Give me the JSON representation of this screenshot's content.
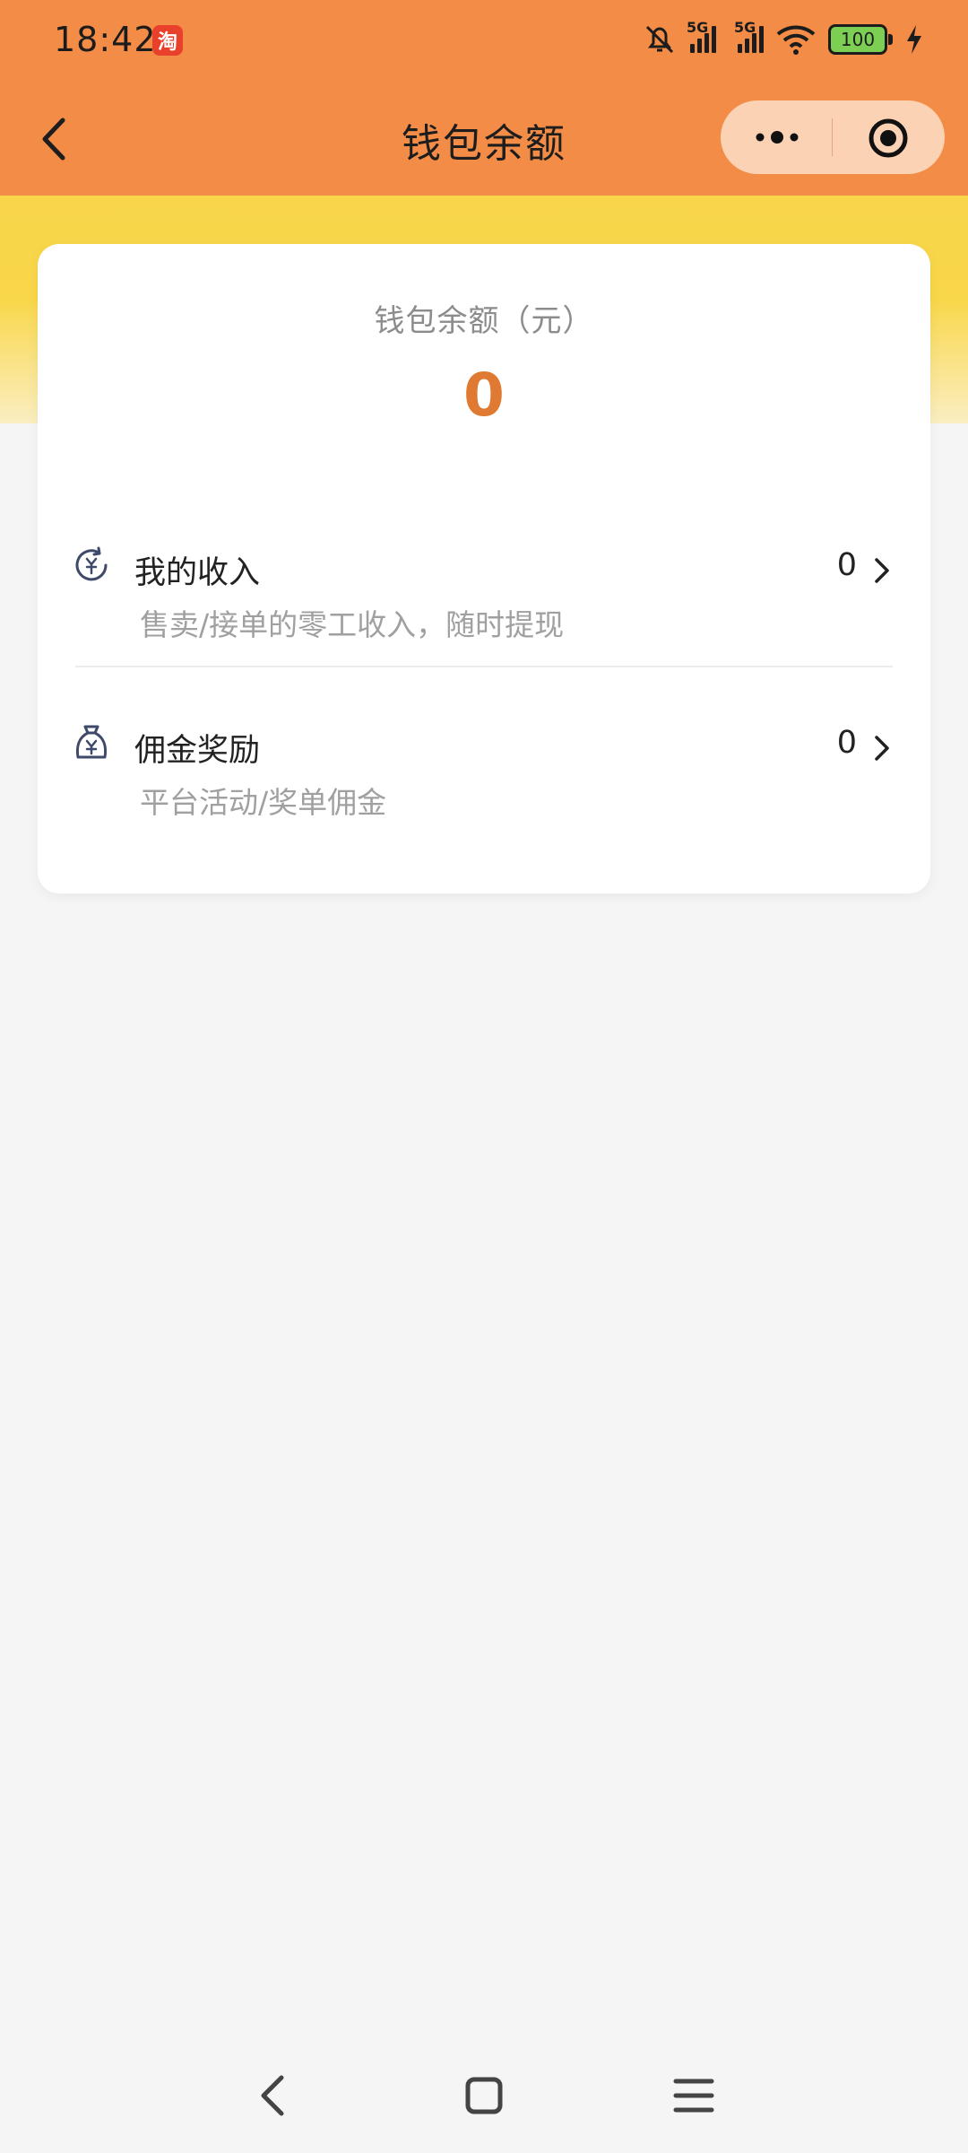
{
  "status": {
    "time": "18:42",
    "app_icon": "淘",
    "network1": "5G",
    "network2": "5G",
    "battery": "100"
  },
  "header": {
    "title": "钱包余额",
    "back_icon": "back-chevron-icon",
    "more_icon": "more-dots-icon",
    "close_icon": "target-circle-icon"
  },
  "card": {
    "label": "钱包余额（元）",
    "amount": "0",
    "rows": [
      {
        "title": "我的收入",
        "desc": "售卖/接单的零工收入，随时提现",
        "value": "0",
        "icon": "income-clock-icon"
      },
      {
        "title": "佣金奖励",
        "desc": "平台活动/奖单佣金",
        "value": "0",
        "icon": "money-bag-icon"
      }
    ]
  },
  "colors": {
    "header": "#f28c46",
    "accent": "#e07a32",
    "band": "#f8d54a"
  },
  "nav": {
    "back_icon": "nav-back-icon",
    "home_icon": "nav-home-icon",
    "menu_icon": "nav-menu-icon"
  }
}
